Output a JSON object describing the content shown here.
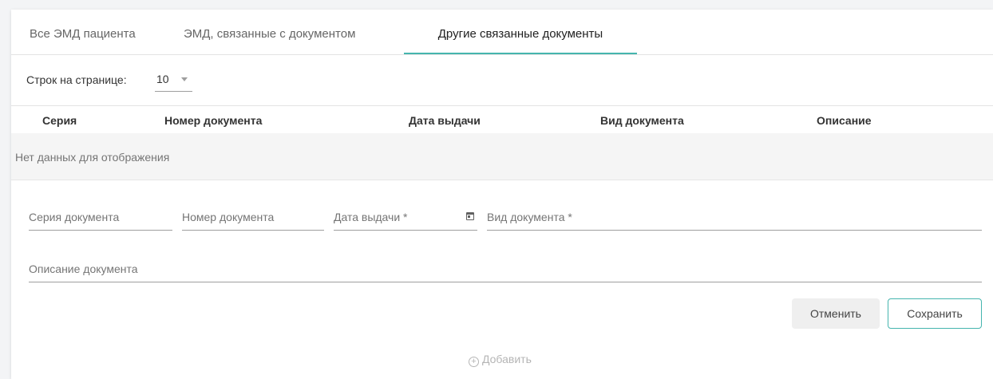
{
  "tabs": [
    {
      "label": "Все ЭМД пациента",
      "active": false
    },
    {
      "label": "ЭМД, связанные с документом",
      "active": false
    },
    {
      "label": "Другие связанные документы",
      "active": true
    }
  ],
  "pagination": {
    "rows_label": "Строк на странице:",
    "rows_value": "10"
  },
  "table": {
    "columns": [
      "Серия",
      "Номер документа",
      "Дата выдачи",
      "Вид документа",
      "Описание"
    ],
    "empty_text": "Нет данных для отображения"
  },
  "form": {
    "series_placeholder": "Серия документа",
    "number_placeholder": "Номер документа",
    "date_placeholder": "Дата выдачи *",
    "type_placeholder": "Вид документа *",
    "description_placeholder": "Описание документа"
  },
  "buttons": {
    "cancel": "Отменить",
    "save": "Сохранить",
    "add": "Добавить"
  },
  "colors": {
    "accent": "#45b5ae"
  },
  "icons": {
    "calendar": "calendar-icon",
    "add": "plus-circle-icon",
    "dropdown": "chevron-down-icon"
  }
}
